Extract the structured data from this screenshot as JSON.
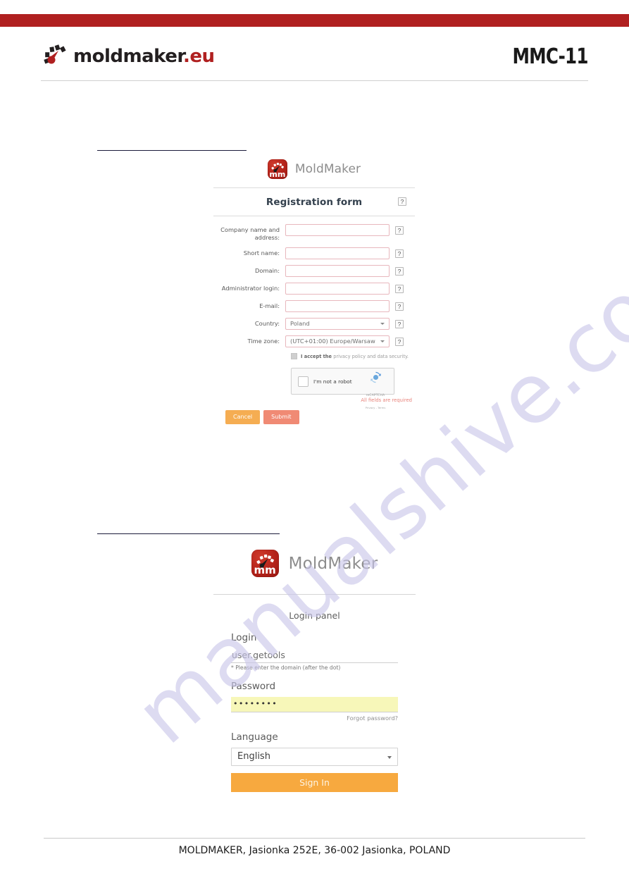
{
  "header": {
    "brand_name": "moldmaker",
    "brand_dot": ".",
    "brand_tld": "eu",
    "model_code": "MMC-11"
  },
  "watermark": {
    "text": "manualshive.com"
  },
  "registration": {
    "logo_name": "MoldMaker",
    "title": "Registration form",
    "help_glyph": "?",
    "fields": [
      {
        "label": "Company name and address:",
        "value": "",
        "type": "text"
      },
      {
        "label": "Short name:",
        "value": "",
        "type": "text"
      },
      {
        "label": "Domain:",
        "value": "",
        "type": "text"
      },
      {
        "label": "Administrator login:",
        "value": "",
        "type": "text"
      },
      {
        "label": "E-mail:",
        "value": "",
        "type": "text"
      },
      {
        "label": "Country:",
        "value": "Poland",
        "type": "select"
      },
      {
        "label": "Time zone:",
        "value": "(UTC+01:00) Europe/Warsaw",
        "type": "select"
      }
    ],
    "consent": {
      "strong": "I accept the ",
      "rest": "privacy policy and data security."
    },
    "recaptcha": {
      "label": "I'm not a robot",
      "brand": "reCAPTCHA",
      "links": "Privacy - Terms"
    },
    "required_note": "All fields are required",
    "buttons": {
      "cancel": "Cancel",
      "submit": "Submit"
    },
    "accent_border": "#e8b7bd",
    "cancel_color": "#f5ad52",
    "submit_color": "#f08a74"
  },
  "login": {
    "logo_name": "MoldMaker",
    "panel_title": "Login panel",
    "login_label": "Login",
    "login_value": "user.getools",
    "login_hint": "* Please enter the domain (after the dot)",
    "password_label": "Password",
    "password_value": "••••••••",
    "forgot_label": "Forgot password?",
    "language_label": "Language",
    "language_value": "English",
    "signin_label": "Sign In",
    "signin_color": "#f7a93f",
    "autofill_color": "#f7f7b9"
  },
  "footer": {
    "text": "MOLDMAKER, Jasionka 252E, 36-002 Jasionka, POLAND"
  }
}
